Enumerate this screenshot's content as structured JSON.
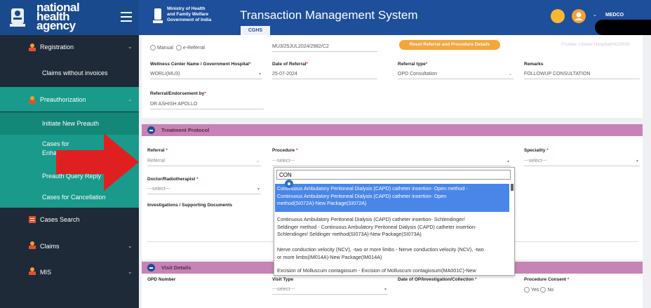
{
  "header": {
    "brand_line1": "national",
    "brand_line2": "health",
    "brand_line3": "agency",
    "ministry_line1": "Ministry of Health",
    "ministry_line2": "and Family Welfare",
    "ministry_line3": "Government of India",
    "system_title": "Transaction Management System",
    "tab_label": "CGHS",
    "user_label": "MEDCO"
  },
  "sidebar": {
    "items": [
      {
        "label": "Registration",
        "icon": "user-icon"
      },
      {
        "label": "Claims without invoices"
      },
      {
        "label": "Preauthorization",
        "icon": "user-icon"
      },
      {
        "label": "Initiate New Preauth"
      },
      {
        "label_line1": "Cases for",
        "label_line2": "Enha"
      },
      {
        "label": "Preauth Query Reply"
      },
      {
        "label": "Cases for Cancellation"
      },
      {
        "label": "Cases Search",
        "icon": "search-file-icon"
      },
      {
        "label": "Claims",
        "icon": "user-icon"
      },
      {
        "label": "MIS",
        "icon": "user-icon"
      }
    ]
  },
  "referral": {
    "manual_label": "Manual",
    "ereferral_label": "e-Referral",
    "referral_number": "MU3/25JUL2024/2982/C2",
    "reset_button": "Reset Referral and Procedure Details",
    "frontier_text": "Frontier Lifeline Hospital(HOSP33",
    "wellness_label": "Wellness Center Name / Government Hospital",
    "wellness_value": "WORLI(MU3)",
    "date_label": "Date of Referral",
    "date_value": "25-07-2024",
    "type_label": "Referral type",
    "type_value": "OPD Consultation",
    "remarks_label": "Remarks",
    "remarks_value": "FOLLOWUP CONSULTATION",
    "endorse_label": "Referral/Endorsement by",
    "endorse_value": "DR ASHISH APOLLO"
  },
  "treatment": {
    "title": "Treatment Protocol",
    "referral_label": "Referral",
    "referral_value": "Referral",
    "procedure_label": "Procedure",
    "procedure_value": "---select---",
    "speciality_label": "Speciality",
    "speciality_value": "---select---",
    "doctor_label": "Doctor/Radiotherapist",
    "doctor_value": "---select---",
    "investigations_label": "Investigations / Supporting Documents"
  },
  "procedure_dropdown": {
    "search_value": "CON",
    "options": [
      [
        "Continuous Ambulatory Peritoneal Dialysis (CAPD) catheter insertion- Open method -",
        "Continuous Ambulatory Peritoneal Dialysis (CAPD) catheter insertion- Open",
        "method(SI072A)-New Package(SI072A)"
      ],
      [
        "Continuous Ambulatory Peritoneal Dialysis (CAPD) catheter insertion- Schlendinger/",
        "Seldinger method - Continuous Ambulatory Peritoneal Dialysis (CAPD) catheter insertion-",
        "Schlendinger/ Seldinger method(SI073A)-New Package(SI073A)"
      ],
      [
        "Nerve conduction velocity (NCV), -two or more limbs - Nerve conduction velocity (NCV), -two",
        "or more limbs(IM014A)-New Package(IM014A)"
      ],
      [
        "Excision of Molluscum contagiosum - Excision of Molluscum contagiosum(MA001C)-New"
      ]
    ]
  },
  "visit": {
    "title": "Visit Details",
    "opd_label": "OPD Number",
    "visit_type_label": "Visit Type",
    "visit_type_value": "---select---",
    "date_label": "Date of OP/Investigation/Collection",
    "consent_label": "Procedure Consent",
    "yes_label": "Yes",
    "no_label": "No"
  },
  "colors": {
    "header_blue": "#1d4f9a",
    "sidebar_dark": "#1e2a38",
    "sidebar_active": "#1a9a8a",
    "section_pink": "#c783b5",
    "highlight_blue": "#4a86e8",
    "annotation_red": "#e02020"
  }
}
